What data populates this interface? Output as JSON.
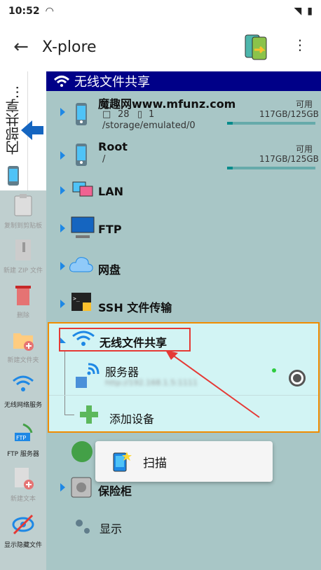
{
  "status": {
    "time": "10:52"
  },
  "app": {
    "title": "X-plore"
  },
  "side_tab": {
    "label": "内部共享..."
  },
  "toolbar": {
    "items": [
      {
        "label": "复制到剪贴板",
        "active": false
      },
      {
        "label": "新建 ZIP 文件",
        "active": false
      },
      {
        "label": "删除",
        "active": false
      },
      {
        "label": "新建文件夹",
        "active": false
      },
      {
        "label": "无线网络服务",
        "active": true
      },
      {
        "label": "FTP 服务器",
        "active": true
      },
      {
        "label": "新建文本",
        "active": false
      },
      {
        "label": "显示隐藏文件",
        "active": true
      }
    ]
  },
  "panel": {
    "header": "无线文件共享",
    "entries": [
      {
        "name": "魔趣网www.mfunz.com",
        "folders": "28",
        "files": "1",
        "path": "/storage/emulated/0",
        "available": "可用",
        "capacity": "117GB/125GB"
      },
      {
        "name": "Root",
        "path": "/",
        "available": "可用",
        "capacity": "117GB/125GB"
      },
      {
        "name": "LAN"
      },
      {
        "name": "FTP"
      },
      {
        "name": "网盘"
      },
      {
        "name": "SSH 文件传输"
      }
    ],
    "wifi_share": {
      "title": "无线文件共享",
      "server_label": "服务器",
      "server_sub": "http://192.168.1.5:1111",
      "add_device": "添加设备"
    },
    "after": [
      {
        "name": "保险柜"
      },
      {
        "name": "显示"
      }
    ]
  },
  "popup": {
    "label": "扫描"
  },
  "colors": {
    "header_bg": "#000088",
    "panel_bg": "#a8c6c6",
    "highlight_border": "#f08c00",
    "annotation": "#e53935"
  }
}
